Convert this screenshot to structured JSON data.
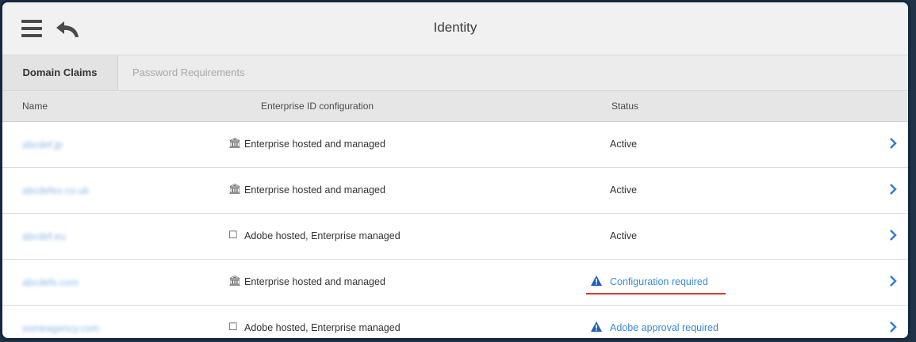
{
  "header": {
    "title": "Identity"
  },
  "tabs": [
    {
      "label": "Domain Claims",
      "active": true
    },
    {
      "label": "Password Requirements",
      "active": false
    }
  ],
  "table": {
    "columns": [
      "Name",
      "Enterprise ID configuration",
      "Status"
    ],
    "rows": [
      {
        "name": "abcdef.jp",
        "config_icon": "bank-icon",
        "config": "Enterprise hosted and managed",
        "status": "Active",
        "status_type": "ok"
      },
      {
        "name": "abcdefex.co.uk",
        "config_icon": "bank-icon",
        "config": "Enterprise hosted and managed",
        "status": "Active",
        "status_type": "ok"
      },
      {
        "name": "abcdef.eu",
        "config_icon": "adobe-icon",
        "config": "Adobe hosted, Enterprise managed",
        "status": "Active",
        "status_type": "ok"
      },
      {
        "name": "abcdefx.com",
        "config_icon": "bank-icon",
        "config": "Enterprise hosted and managed",
        "status": "Configuration required",
        "status_type": "warning"
      },
      {
        "name": "someagency.com",
        "config_icon": "adobe-icon",
        "config": "Adobe hosted, Enterprise managed",
        "status": "Adobe approval required",
        "status_type": "warning"
      }
    ]
  },
  "colors": {
    "link": "#3b8ad8",
    "warning_icon": "#1f5fb8",
    "highlight_underline": "#d73a3a"
  }
}
